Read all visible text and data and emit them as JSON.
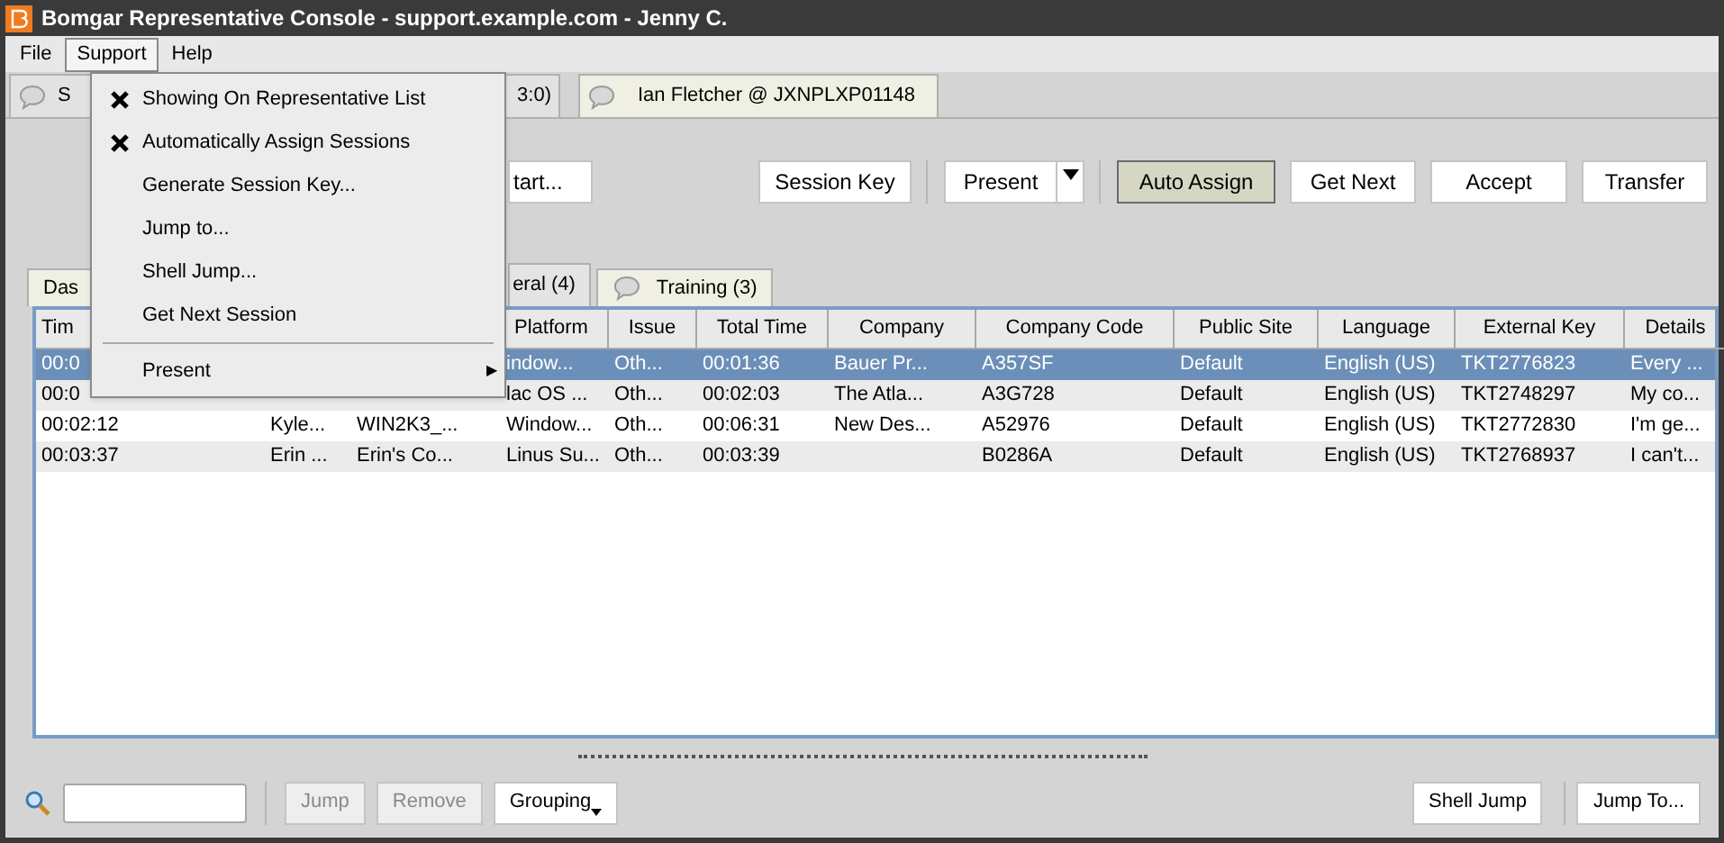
{
  "window": {
    "title": "Bomgar Representative Console - support.example.com - Jenny C."
  },
  "menu_bar": [
    {
      "label": "File",
      "selected": false
    },
    {
      "label": "Support",
      "selected": true
    },
    {
      "label": "Help",
      "selected": false
    }
  ],
  "support_menu": [
    {
      "kind": "check",
      "label": "Showing On Representative List",
      "checked": true
    },
    {
      "kind": "check",
      "label": "Automatically Assign Sessions",
      "checked": true
    },
    {
      "kind": "check",
      "label": "Generate Session Key...",
      "checked": false
    },
    {
      "kind": "check",
      "label": "Jump to...",
      "checked": false
    },
    {
      "kind": "check",
      "label": "Shell Jump...",
      "checked": false
    },
    {
      "kind": "check",
      "label": "Get Next Session",
      "checked": false
    },
    {
      "kind": "separator"
    },
    {
      "kind": "submenu",
      "label": "Present",
      "arrow": "▶"
    }
  ],
  "session_tabs": [
    {
      "label_start": "S",
      "label_end": "3:0)",
      "selected": true
    },
    {
      "label": "Ian Fletcher @ JXNPLXP01148",
      "selected": false
    }
  ],
  "toolbar": [
    {
      "kind": "button",
      "label": "tart...",
      "pressed": false,
      "separator_before": false
    },
    {
      "kind": "button",
      "label": "Session Key",
      "pressed": false,
      "separator_before": false
    },
    {
      "kind": "dropdown",
      "label": "Present",
      "pressed": false,
      "separator_before": true
    },
    {
      "kind": "button",
      "label": "Auto Assign",
      "pressed": true,
      "separator_before": true
    },
    {
      "kind": "button",
      "label": "Get Next",
      "pressed": false,
      "separator_before": false
    },
    {
      "kind": "button",
      "label": "Accept",
      "pressed": false,
      "separator_before": false
    },
    {
      "kind": "button",
      "label": "Transfer",
      "pressed": false,
      "separator_before": false
    }
  ],
  "queue_tabs": [
    {
      "label": "Das",
      "selected": false,
      "icon": false
    },
    {
      "label": "eral (4)",
      "selected": true,
      "icon": false
    },
    {
      "label": "Training (3)",
      "selected": false,
      "icon": true
    }
  ],
  "table": {
    "header": {
      "time": "Tim",
      "platform": "Platform",
      "issue": "Issue",
      "total_time": "Total Time",
      "company": "Company",
      "company_code": "Company Code",
      "public_site": "Public Site",
      "language": "Language",
      "external_key": "External Key",
      "details": "Details"
    },
    "rows": [
      {
        "selected": true,
        "time": "00:0",
        "platform": "indow...",
        "issue": "Oth...",
        "total_time": "00:01:36",
        "company": "Bauer Pr...",
        "company_code": "A357SF",
        "public_site": "Default",
        "language": "English (US)",
        "external_key": "TKT2776823",
        "details": "Every ..."
      },
      {
        "selected": false,
        "time": "00:0",
        "platform": "lac OS ...",
        "issue": "Oth...",
        "total_time": "00:02:03",
        "company": "The Atla...",
        "company_code": "A3G728",
        "public_site": "Default",
        "language": "English (US)",
        "external_key": "TKT2748297",
        "details": "My co..."
      },
      {
        "selected": false,
        "time": "00:02:12",
        "column_2": "Kyle...",
        "column_3": "WIN2K3_...",
        "platform": "Window...",
        "issue": "Oth...",
        "total_time": "00:06:31",
        "company": "New Des...",
        "company_code": "A52976",
        "public_site": "Default",
        "language": "English (US)",
        "external_key": "TKT2772830",
        "details": "I'm ge..."
      },
      {
        "selected": false,
        "time": "00:03:37",
        "column_2": "Erin ...",
        "column_3": "Erin's Co...",
        "platform": "Linus Su...",
        "issue": "Oth...",
        "total_time": "00:03:39",
        "company_code": "B0286A",
        "public_site": "Default",
        "language": "English (US)",
        "external_key": "TKT2768937",
        "details": "I can't..."
      }
    ]
  },
  "bottom_bar": {
    "left_buttons": [
      {
        "label": "Jump",
        "disabled": true,
        "dropdown": false
      },
      {
        "label": "Remove",
        "disabled": true,
        "dropdown": false
      },
      {
        "label": "Grouping",
        "disabled": false,
        "dropdown": true
      }
    ],
    "right_buttons": [
      {
        "label": "Shell Jump",
        "disabled": false
      },
      {
        "label": "Jump To...",
        "disabled": false
      }
    ]
  }
}
